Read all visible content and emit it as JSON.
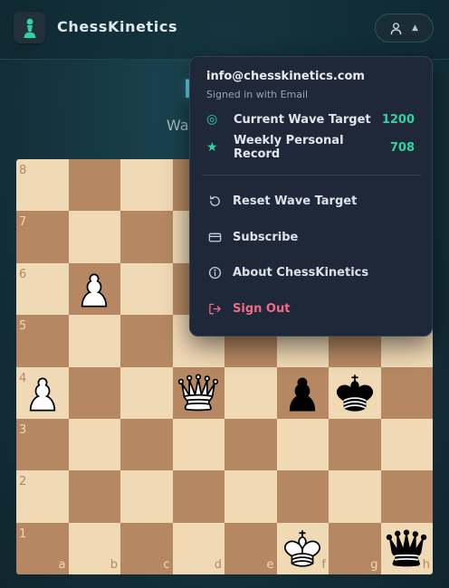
{
  "header": {
    "brand": "ChessKinetics",
    "logo_icon": "chess-pawn-icon",
    "user_icon": "user-icon",
    "caret_glyph": "▲"
  },
  "hero": {
    "title": "buffe",
    "subtitle": "Warm up and re"
  },
  "board": {
    "files": [
      "a",
      "b",
      "c",
      "d",
      "e",
      "f",
      "g",
      "h"
    ],
    "ranks": [
      "8",
      "7",
      "6",
      "5",
      "4",
      "3",
      "2",
      "1"
    ],
    "pieces": [
      {
        "square": "b6",
        "piece": "white-pawn"
      },
      {
        "square": "a4",
        "piece": "white-pawn"
      },
      {
        "square": "d4",
        "piece": "white-queen"
      },
      {
        "square": "f4",
        "piece": "black-pawn"
      },
      {
        "square": "g4",
        "piece": "black-king"
      },
      {
        "square": "f1",
        "piece": "white-king"
      },
      {
        "square": "h1",
        "piece": "black-queen"
      }
    ],
    "colors": {
      "light": "#f0d9b5",
      "dark": "#b58863"
    }
  },
  "menu": {
    "email": "info@chesskinetics.com",
    "signed_in": "Signed in with Email",
    "stats": [
      {
        "icon": "target-icon",
        "glyph": "◎",
        "label": "Current Wave Target",
        "value": "1200"
      },
      {
        "icon": "star-icon",
        "glyph": "★",
        "label": "Weekly Personal Record",
        "value": "708"
      }
    ],
    "items": [
      {
        "id": "reset",
        "icon": "reset-icon",
        "label": "Reset Wave Target"
      },
      {
        "id": "subscribe",
        "icon": "card-icon",
        "label": "Subscribe"
      },
      {
        "id": "about",
        "icon": "info-icon",
        "label": "About ChessKinetics"
      },
      {
        "id": "signout",
        "icon": "sign-out-icon",
        "label": "Sign Out"
      }
    ],
    "accent": "#2fd3a0",
    "danger": "#f06a85"
  }
}
